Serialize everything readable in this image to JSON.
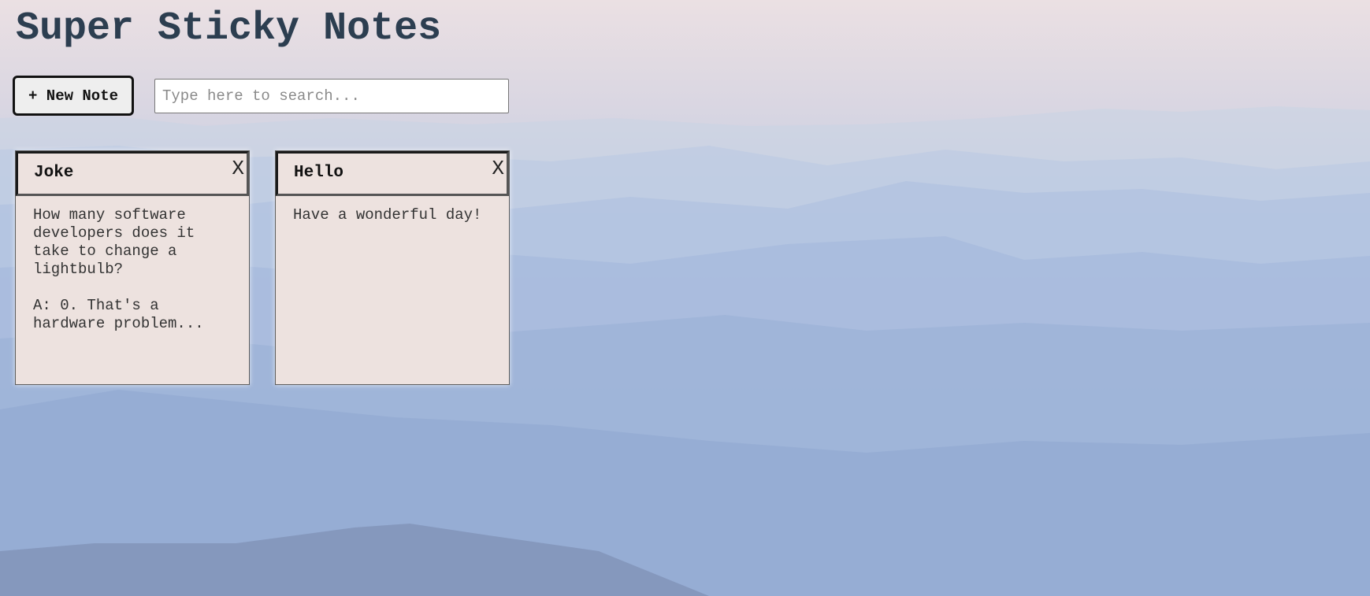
{
  "app": {
    "title": "Super Sticky Notes"
  },
  "toolbar": {
    "new_note_label": "+ New Note",
    "search_placeholder": "Type here to search...",
    "search_value": ""
  },
  "notes": [
    {
      "title": "Joke",
      "close_label": "X",
      "body": "How many software developers does it take to change a lightbulb?\n\nA: 0. That's a hardware problem..."
    },
    {
      "title": "Hello",
      "close_label": "X",
      "body": "Have a wonderful day!"
    }
  ],
  "colors": {
    "title": "#2c3e50",
    "note_background": "#ede2df",
    "button_background": "#eeeeee"
  }
}
